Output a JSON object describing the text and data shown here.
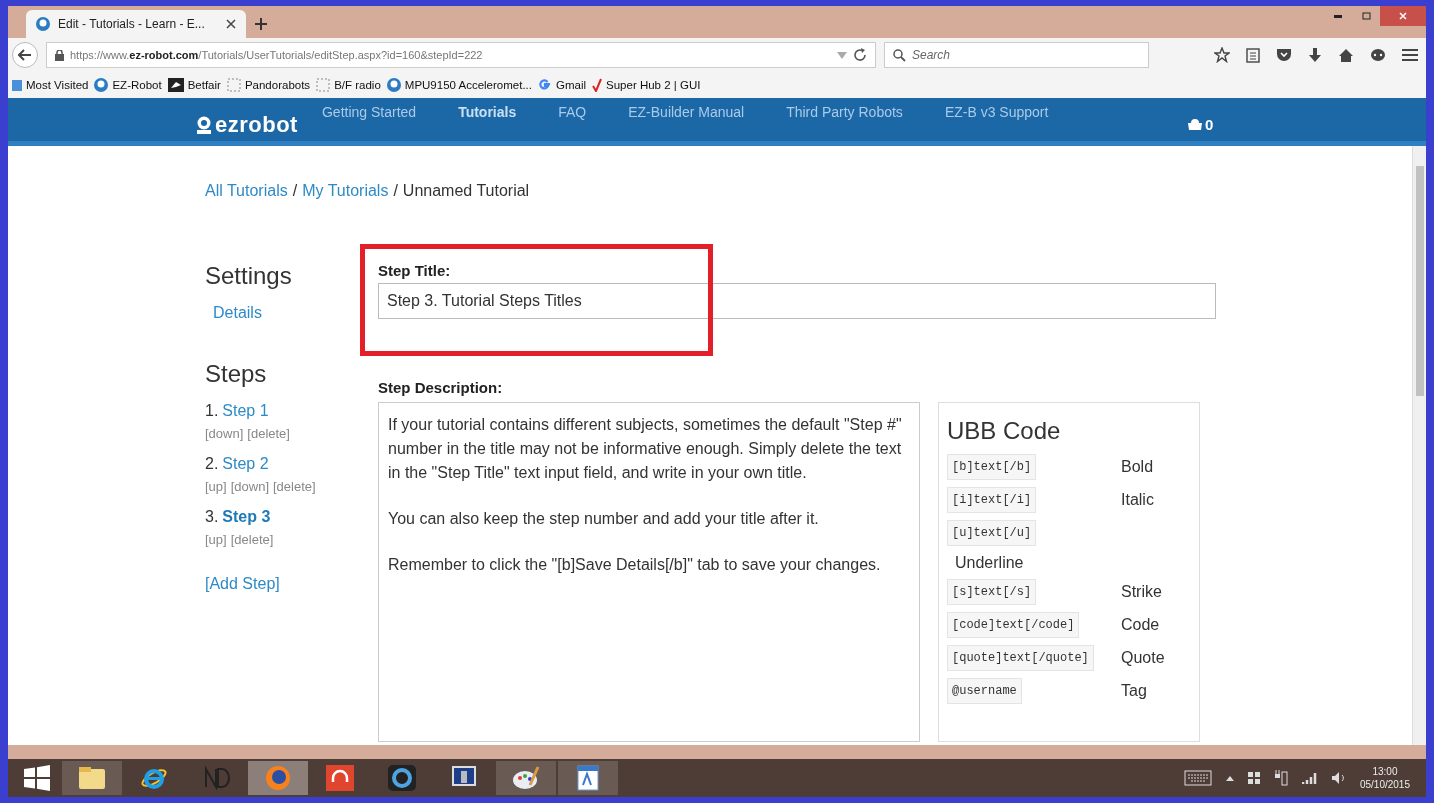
{
  "browser": {
    "tab_title": "Edit - Tutorials - Learn - E...",
    "url": "https://www.**ez-robot.com**/Tutorials/UserTutorials/editStep.aspx?id=160&stepId=222",
    "search_placeholder": "Search"
  },
  "bookmarks": [
    {
      "label": "Most Visited",
      "kind": "folder"
    },
    {
      "label": "EZ-Robot",
      "kind": "robot"
    },
    {
      "label": "Betfair",
      "kind": "flag"
    },
    {
      "label": "Pandorabots",
      "kind": "blank"
    },
    {
      "label": "B/F radio",
      "kind": "blank"
    },
    {
      "label": "MPU9150 Acceleromet...",
      "kind": "robot"
    },
    {
      "label": "Gmail",
      "kind": "google"
    },
    {
      "label": "Super Hub 2 | GUI",
      "kind": "tick"
    }
  ],
  "site": {
    "logo": "ezrobot",
    "nav": [
      {
        "label": "Getting Started",
        "selected": false
      },
      {
        "label": "Tutorials",
        "selected": true
      },
      {
        "label": "FAQ",
        "selected": false
      },
      {
        "label": "EZ-Builder Manual",
        "selected": false
      },
      {
        "label": "Third Party Robots",
        "selected": false
      },
      {
        "label": "EZ-B v3 Support",
        "selected": false
      }
    ],
    "cart_count": "0"
  },
  "breadcrumb": {
    "separator": "/",
    "items": [
      {
        "label": "All Tutorials",
        "link": true
      },
      {
        "label": "My Tutorials",
        "link": true
      },
      {
        "label": "Unnamed Tutorial",
        "link": false
      }
    ]
  },
  "sidebar": {
    "settings_heading": "Settings",
    "settings_link": "Details",
    "steps_heading": "Steps",
    "steps": [
      {
        "number": "1.",
        "label": "Step 1",
        "selected": false,
        "actions": [
          "[down]",
          "[delete]"
        ]
      },
      {
        "number": "2.",
        "label": "Step 2",
        "selected": false,
        "actions": [
          "[up]",
          "[down]",
          "[delete]"
        ]
      },
      {
        "number": "3.",
        "label": "Step 3",
        "selected": true,
        "actions": [
          "[up]",
          "[delete]"
        ]
      }
    ],
    "add_step": "[Add Step]"
  },
  "step_title": {
    "label": "Step Title:",
    "value": "Step 3. Tutorial Steps Titles"
  },
  "step_description": {
    "label": "Step Description:",
    "paragraphs": [
      "If your tutorial contains different subjects, sometimes the default \"Step #\" number in the title may not be informative enough. Simply delete the text in the \"Step Title\" text input field, and write in your own title.",
      "You can also keep the step number and add your title after it.",
      "Remember to click the \"[b]Save Details[/b]\" tab to save your changes."
    ]
  },
  "ubb": {
    "heading": "UBB Code",
    "rows": [
      {
        "code": "[b]text[/b]",
        "label": "Bold",
        "kind": "inline"
      },
      {
        "code": "[i]text[/i]",
        "label": "Italic",
        "kind": "inline"
      },
      {
        "code": "[u]text[/u]",
        "label": "Underline",
        "kind": "stacked"
      },
      {
        "code": "[s]text[/s]",
        "label": "Strike",
        "kind": "inline"
      },
      {
        "code": "[code]text[/code]",
        "label": "Code",
        "kind": "inline"
      },
      {
        "code": "[quote]text[/quote]",
        "label": "Quote",
        "kind": "inline"
      },
      {
        "code": "@username",
        "label": "Tag",
        "kind": "inline"
      }
    ]
  },
  "taskbar": {
    "apps": [
      {
        "kind": "folder",
        "running": true,
        "selected": false
      },
      {
        "kind": "ie",
        "running": false,
        "selected": false
      },
      {
        "kind": "nd",
        "running": false,
        "selected": false
      },
      {
        "kind": "firefox",
        "running": true,
        "selected": true
      },
      {
        "kind": "headphones",
        "running": false,
        "selected": false
      },
      {
        "kind": "ring",
        "running": false,
        "selected": false
      },
      {
        "kind": "monitor",
        "running": false,
        "selected": false
      },
      {
        "kind": "paint",
        "running": true,
        "selected": false
      },
      {
        "kind": "doc",
        "running": true,
        "selected": false
      }
    ],
    "time": "13:00",
    "date": "05/10/2015"
  }
}
